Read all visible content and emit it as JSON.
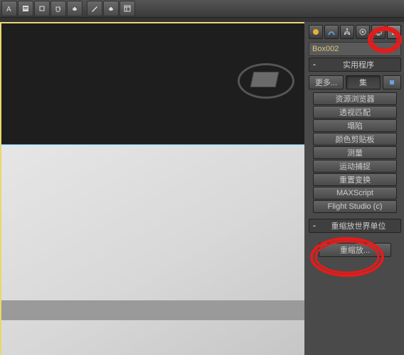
{
  "object_name": "Box002",
  "rollups": {
    "utilities_title": "实用程序",
    "rescale_title": "重缩放世界单位"
  },
  "util_buttons": {
    "more": "更多...",
    "sets": "集"
  },
  "utilities_list": [
    "资源浏览器",
    "透视匹配",
    "塌陷",
    "颜色剪贴板",
    "测量",
    "运动捕捉",
    "重置变换",
    "MAXScript",
    "Flight Studio (c)"
  ],
  "rescale_btn": "重缩放...",
  "tab_icons": [
    "sun",
    "arc",
    "link",
    "sphere",
    "screen",
    "hammer"
  ],
  "toolbar_icons": [
    "text",
    "script",
    "box",
    "cup",
    "teapot1",
    "pen",
    "teapot2",
    "panel"
  ]
}
